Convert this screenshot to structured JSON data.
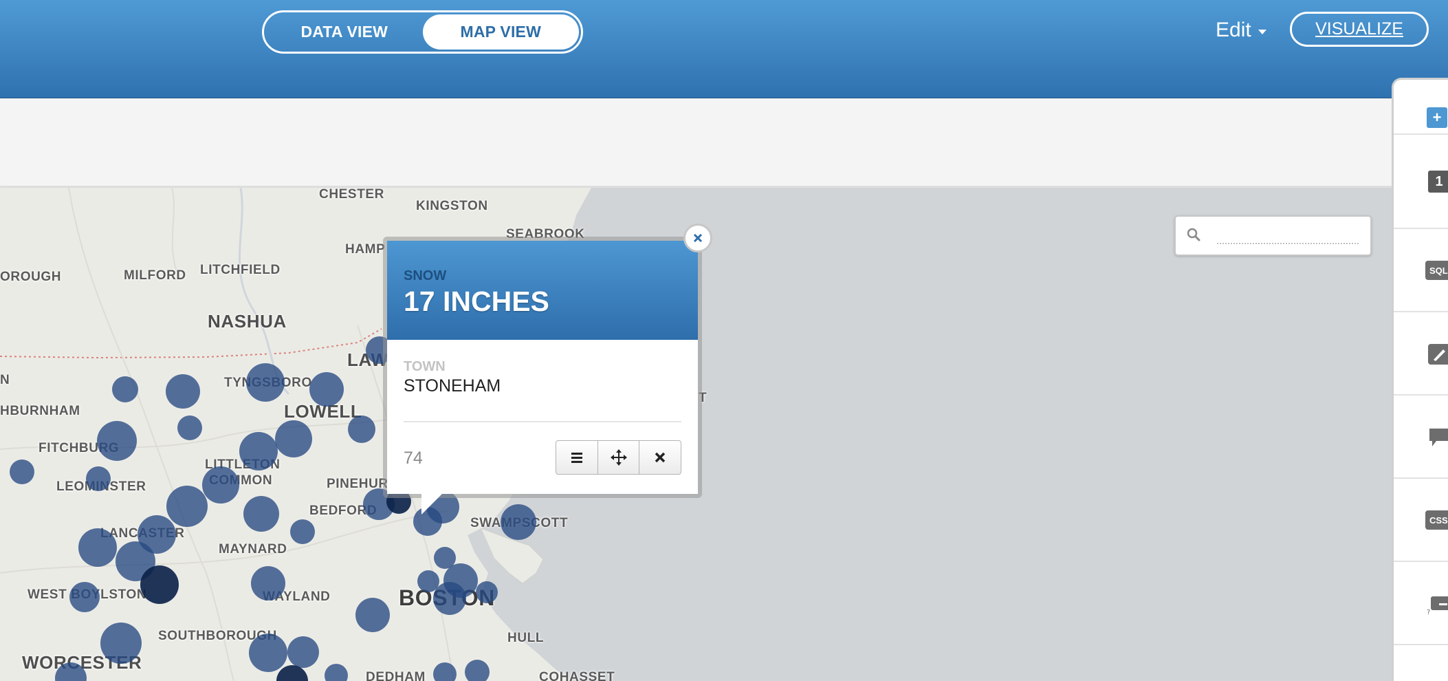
{
  "header": {
    "view_toggle": {
      "data_view": "DATA VIEW",
      "map_view": "MAP VIEW",
      "active": "map_view"
    },
    "edit_label": "Edit",
    "visualize_label": "VISUALIZE"
  },
  "map": {
    "labels": [
      "CHESTER",
      "KINGSTON",
      "SEABROOK",
      "HAMP",
      "MILFORD",
      "LITCHFIELD",
      "NASHUA",
      "OROUGH",
      "LAW",
      "TYNGSBORO",
      "LOWELL",
      "HBURNHAM",
      "FITCHBURG",
      "LITTLETON",
      "COMMON",
      "LEOMINSTER",
      "PINEHUR",
      "BEDFORD",
      "LANCASTER",
      "MAYNARD",
      "SWAMPSCOTT",
      "WEST BOYLSTON",
      "WAYLAND",
      "BOSTON",
      "SOUTHBOROUGH",
      "HULL",
      "WORCESTER",
      "DEDHAM",
      "COHASSET",
      "T",
      "N"
    ],
    "search_placeholder": "",
    "bubble_color": "#264982",
    "land_color": "#ebebe6",
    "water_color": "#d0d4d7"
  },
  "popup": {
    "field1_label": "SNOW",
    "field1_value": "17 INCHES",
    "field2_label": "TOWN",
    "field2_value": "STONEHAM",
    "count": "74",
    "buttons": [
      "list-icon",
      "move-icon",
      "close-icon"
    ],
    "close_icon": "close-icon"
  },
  "right_panel": {
    "add_icon": "plus-icon",
    "layer_number": "1",
    "sql_label": "SQL",
    "wizard_icon": "paintbrush-icon",
    "infowindow_icon": "speech-bubble-icon",
    "css_label": "CSS",
    "legend_icon": "legend-icon"
  }
}
